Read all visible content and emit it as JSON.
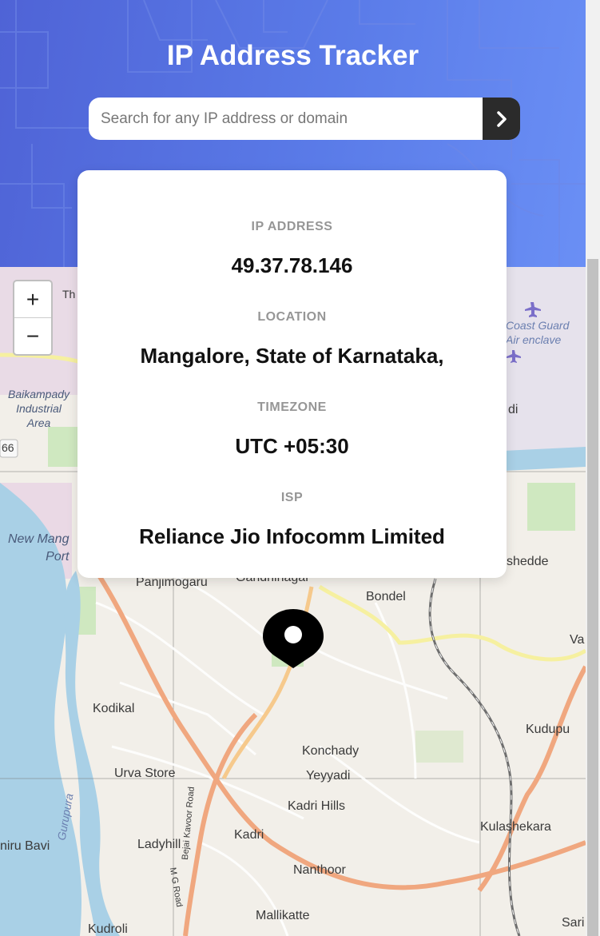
{
  "header": {
    "title": "IP Address Tracker",
    "search_placeholder": "Search for any IP address or domain"
  },
  "info": {
    "ip_label": "IP ADDRESS",
    "ip_value": "49.37.78.146",
    "location_label": "LOCATION",
    "location_value": "Mangalore, State of Karnataka,",
    "timezone_label": "TIMEZONE",
    "timezone_value": "UTC +05:30",
    "isp_label": "ISP",
    "isp_value": "Reliance Jio Infocomm Limited"
  },
  "map": {
    "zoom_in": "+",
    "zoom_out": "−",
    "places": {
      "th": "Th",
      "baikampady": "Baikampady\nIndustrial\nArea",
      "road66": "66",
      "new_mangalore_port": "New Mang\nPort",
      "coast_guard": "Coast Guard\nAir enclave",
      "di": "di",
      "shedde": "shedde",
      "panjimogaru": "Panjimogaru",
      "gandhinagar": "Gandhinagar",
      "bondel": "Bondel",
      "va": "Va",
      "kodikal": "Kodikal",
      "kudupu": "Kudupu",
      "konchady": "Konchady",
      "urva_store": "Urva Store",
      "yeyyadi": "Yeyyadi",
      "kadri_hills": "Kadri Hills",
      "gurupura": "Gurupura",
      "bejai_kavoor_road": "Bejai Kavoor Road",
      "kulashekara": "Kulashekara",
      "niru_bavi": "niru Bavi",
      "ladyhill": "Ladyhill",
      "kadri": "Kadri",
      "mg_road": "M G Road",
      "nanthoor": "Nanthoor",
      "mallikatte": "Mallikatte",
      "kudroli": "Kudroli",
      "sari": "Sari"
    }
  },
  "colors": {
    "header_gradient_start": "#4f63d6",
    "header_gradient_end": "#6a8ff5",
    "button_dark": "#2b2b2b",
    "marker": "#000000",
    "label_gray": "#969696"
  },
  "icons": {
    "search_button": "chevron-right-icon",
    "marker": "location-pin-icon",
    "airport": "airplane-icon"
  }
}
